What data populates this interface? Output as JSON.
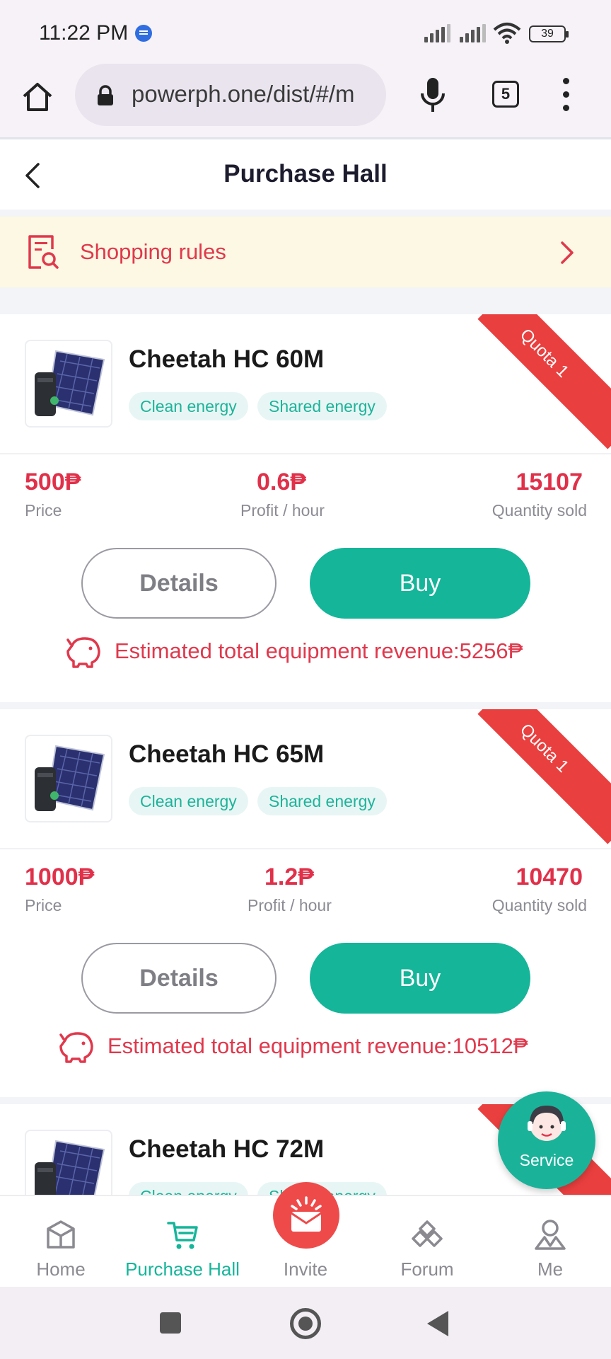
{
  "status_bar": {
    "time": "11:22 PM",
    "battery": "39"
  },
  "browser": {
    "url": "powerph.one/dist/#/m",
    "tab_count": "5"
  },
  "header": {
    "title": "Purchase Hall"
  },
  "rules": {
    "label": "Shopping rules"
  },
  "stat_labels": {
    "price": "Price",
    "profit": "Profit / hour",
    "sold": "Quantity sold"
  },
  "buttons": {
    "details": "Details",
    "buy": "Buy"
  },
  "products": [
    {
      "name": "Cheetah HC 60M",
      "ribbon": "Quota 1",
      "tags": [
        "Clean energy",
        "Shared energy"
      ],
      "price": "500₱",
      "profit": "0.6₱",
      "sold": "15107",
      "revenue": "Estimated total equipment revenue:5256₱"
    },
    {
      "name": "Cheetah HC 65M",
      "ribbon": "Quota 1",
      "tags": [
        "Clean energy",
        "Shared energy"
      ],
      "price": "1000₱",
      "profit": "1.2₱",
      "sold": "10470",
      "revenue": "Estimated total equipment revenue:10512₱"
    },
    {
      "name": "Cheetah HC 72M",
      "ribbon": "Quota 1",
      "tags": [
        "Clean energy",
        "Shared energy"
      ]
    }
  ],
  "service": {
    "label": "Service"
  },
  "nav": [
    {
      "label": "Home",
      "icon": "home-icon"
    },
    {
      "label": "Purchase Hall",
      "icon": "cart-icon"
    },
    {
      "label": "Invite",
      "icon": "gift-icon"
    },
    {
      "label": "Forum",
      "icon": "forum-icon"
    },
    {
      "label": "Me",
      "icon": "user-icon"
    }
  ],
  "colors": {
    "accent": "#15b59a",
    "price_red": "#e0304a",
    "ribbon_red": "#ea3f3f",
    "rules_bg": "#fdf8e3"
  }
}
